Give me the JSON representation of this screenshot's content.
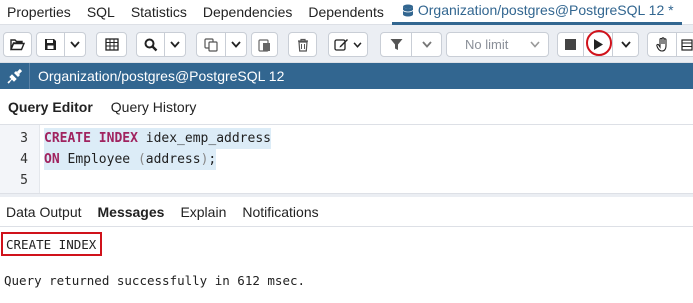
{
  "top_tabs": {
    "items": [
      "Properties",
      "SQL",
      "Statistics",
      "Dependencies",
      "Dependents"
    ],
    "active_label": "Organization/postgres@PostgreSQL 12 *"
  },
  "toolbar": {
    "limit_value": "No limit",
    "icons": [
      "folder-open-icon",
      "save-icon",
      "chevron-down-icon",
      "table-grid-icon",
      "find-icon",
      "chevron-down-icon",
      "copy-icon",
      "chevron-down-icon",
      "paste-icon",
      "delete-icon",
      "edit-icon",
      "chevron-down-icon",
      "filter-icon",
      "chevron-down-icon",
      "stop-icon",
      "run-icon",
      "chevron-down-icon",
      "hand-icon"
    ]
  },
  "connection": {
    "title": "Organization/postgres@PostgreSQL 12"
  },
  "editor_tabs": [
    "Query Editor",
    "Query History"
  ],
  "editor": {
    "lines": [
      {
        "number": "3",
        "keyword": "CREATE INDEX",
        "rest": " idex_emp_address"
      },
      {
        "number": "4",
        "keyword": "ON",
        "rest": " Employee (address);"
      },
      {
        "number": "5",
        "keyword": "",
        "rest": ""
      }
    ]
  },
  "output_tabs": [
    "Data Output",
    "Messages",
    "Explain",
    "Notifications"
  ],
  "messages": {
    "command": "CREATE INDEX",
    "result": "Query returned successfully in 612 msec."
  },
  "colors": {
    "accent": "#326690",
    "keyword": "#a0235f",
    "highlight_line": "#dcecf7",
    "annotation_red": "#d0121b",
    "toolbar_bg": "#ebeef3"
  }
}
